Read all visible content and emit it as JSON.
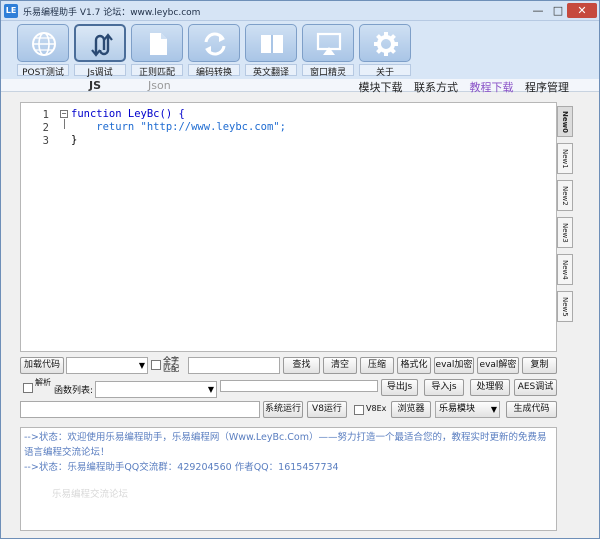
{
  "window": {
    "title": "乐易编程助手 V1.7 论坛：www.leybc.com",
    "logo": "LE",
    "controls": {
      "minimize": "—",
      "maximize": "□",
      "close": "✕"
    }
  },
  "toolbar": {
    "tools": [
      {
        "label": "POST测试",
        "icon": "globe-icon"
      },
      {
        "label": "Js调试",
        "icon": "loop-arrows-icon",
        "active": true
      },
      {
        "label": "正则匹配",
        "icon": "document-icon"
      },
      {
        "label": "编码转换",
        "icon": "refresh-icon"
      },
      {
        "label": "英文翻译",
        "icon": "book-icon"
      },
      {
        "label": "窗口精灵",
        "icon": "window-icon"
      },
      {
        "label": "关于",
        "icon": "gear-icon"
      }
    ]
  },
  "subbar": {
    "tab_js": "JS",
    "tab_json": "Json",
    "menus": [
      "模块下载",
      "联系方式",
      "教程下载",
      "程序管理"
    ],
    "highlight_menu": "教程下载"
  },
  "editor": {
    "lines": [
      {
        "num": "1",
        "text": "function LeyBc() {"
      },
      {
        "num": "2",
        "text": "    return \"http://www.leybc.com\";"
      },
      {
        "num": "3",
        "text": "}"
      }
    ],
    "fold_marker": "−"
  },
  "side_tabs": [
    "New0",
    "New1",
    "New2",
    "New3",
    "New4",
    "New5"
  ],
  "controls": {
    "row1": {
      "load_code": "加载代码",
      "full_match": "全字匹配",
      "find": "查找",
      "clear": "清空",
      "compress": "压缩",
      "format": "格式化",
      "eval_encrypt": "eval加密",
      "eval_decrypt": "eval解密",
      "copy": "复制"
    },
    "row2": {
      "deobfuscate": "解析",
      "function_list": "函数列表:",
      "export_js": "导出Js",
      "import_js": "导入js",
      "process_vars": "处理假",
      "aes_debug": "AES调试"
    },
    "row3": {
      "system_run": "系统运行",
      "v8_run": "V8运行",
      "v8ex": "V8Ex",
      "browser": "浏览器",
      "module_select": "乐易模块",
      "generate_code": "生成代码"
    }
  },
  "log": {
    "lines": [
      "-->状态：欢迎使用乐易编程助手，乐易编程网（Www.LeyBc.Com）——努力打造一个最适合您的，教程实时更新的免费易语言编程交流论坛！",
      "-->状态：乐易编程助手QQ交流群：429204560 作者QQ：1615457734",
      "乐易编程交流论坛"
    ]
  },
  "colors": {
    "title_bar": "#d6e4f5",
    "highlight_menu": "#8a52c7",
    "log_text": "#5a7ec0",
    "close_button": "#c64a3e"
  }
}
